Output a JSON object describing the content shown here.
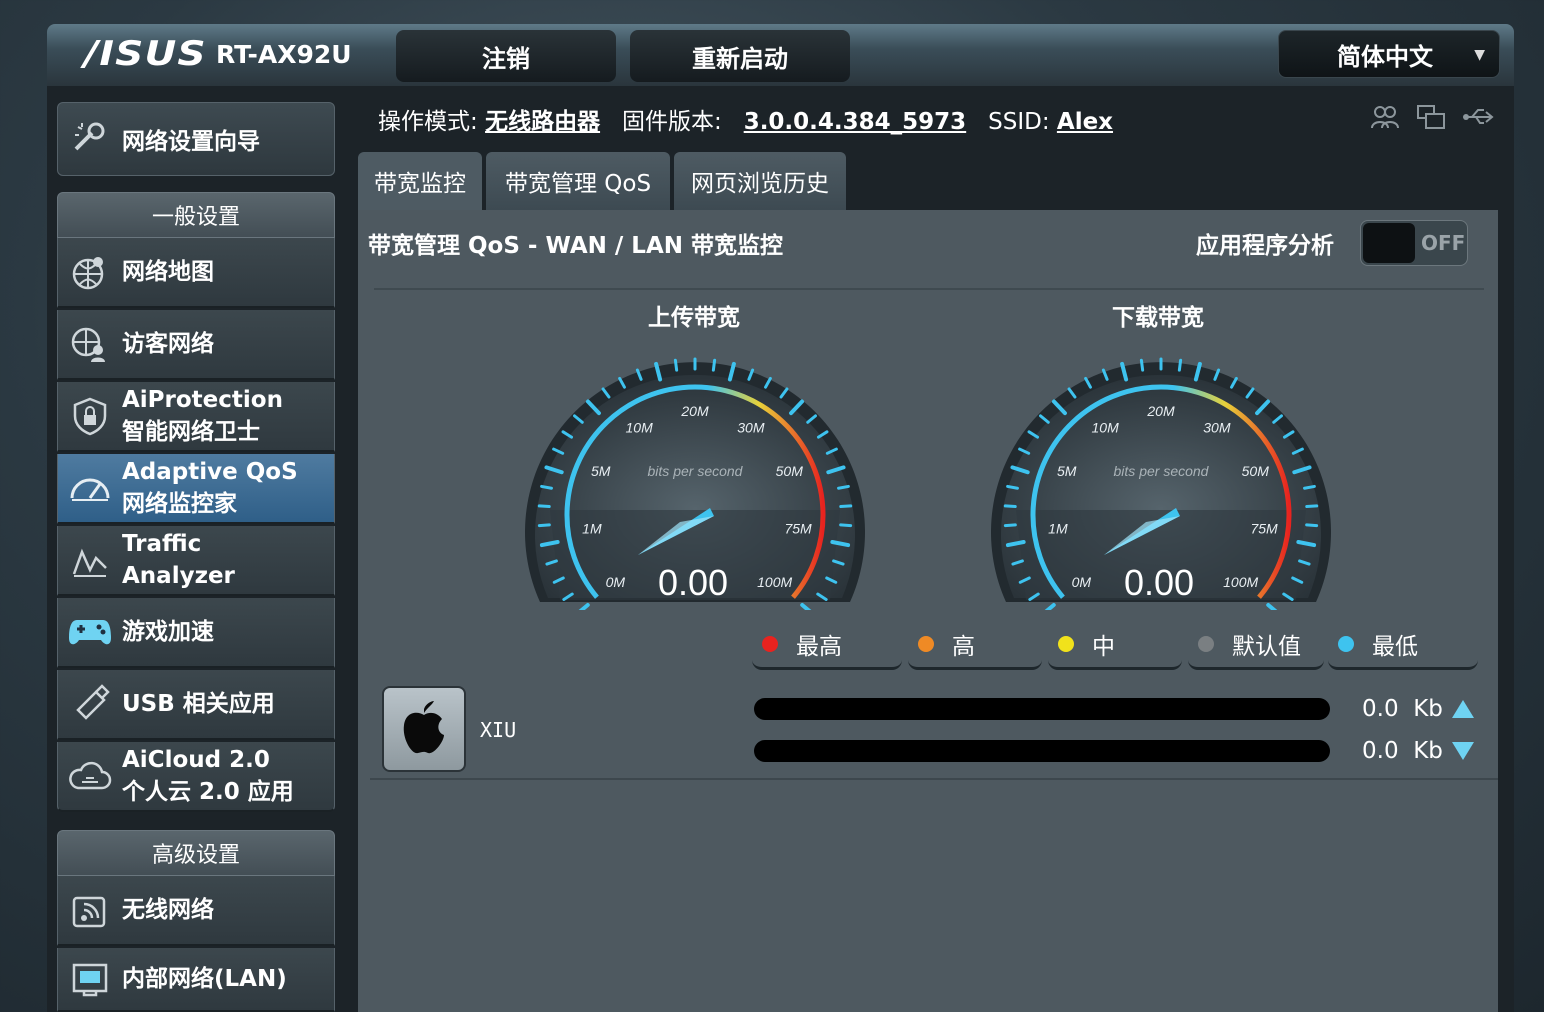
{
  "header": {
    "brand": "/ISUS",
    "model": "RT-AX92U",
    "logout_label": "注销",
    "reboot_label": "重新启动",
    "language": "简体中文"
  },
  "info": {
    "mode_label": "操作模式:",
    "mode_value": "无线路由器",
    "firmware_label": "固件版本:",
    "firmware_value": "3.0.0.4.384_5973",
    "ssid_label": "SSID:",
    "ssid_value": "Alex"
  },
  "sidebar": {
    "wizard": "网络设置向导",
    "general_header": "一般设置",
    "general_items": [
      {
        "label": "网络地图"
      },
      {
        "label": "访客网络"
      },
      {
        "label": "AiProtection",
        "label2": "智能网络卫士"
      },
      {
        "label": "Adaptive QoS",
        "label2": "网络监控家"
      },
      {
        "label": "Traffic",
        "label2": "Analyzer"
      },
      {
        "label": "游戏加速"
      },
      {
        "label": "USB 相关应用"
      },
      {
        "label": "AiCloud 2.0",
        "label2": "个人云 2.0 应用"
      }
    ],
    "advanced_header": "高级设置",
    "advanced_items": [
      {
        "label": "无线网络"
      },
      {
        "label": "内部网络(LAN)"
      }
    ]
  },
  "tabs": [
    "带宽监控",
    "带宽管理 QoS",
    "网页浏览历史"
  ],
  "panel": {
    "title": "带宽管理 QoS - WAN / LAN 带宽监控",
    "app_analysis_label": "应用程序分析",
    "app_analysis_state": "OFF"
  },
  "gauges": [
    {
      "title": "上传带宽",
      "value": "0.00",
      "unit_text": "bits per second",
      "ticks": [
        "0M",
        "1M",
        "5M",
        "10M",
        "20M",
        "30M",
        "50M",
        "75M",
        "100M"
      ]
    },
    {
      "title": "下载带宽",
      "value": "0.00",
      "unit_text": "bits per second",
      "ticks": [
        "0M",
        "1M",
        "5M",
        "10M",
        "20M",
        "30M",
        "50M",
        "75M",
        "100M"
      ]
    }
  ],
  "legend": [
    {
      "label": "最高",
      "color": "#e8231f"
    },
    {
      "label": "高",
      "color": "#ef8a25"
    },
    {
      "label": "中",
      "color": "#f1e21b"
    },
    {
      "label": "默认值",
      "color": "#7a7f82"
    },
    {
      "label": "最低",
      "color": "#3ec3ef"
    }
  ],
  "device": {
    "name": "XIU",
    "icon": "apple-icon",
    "upload_rate": "0.0",
    "upload_unit": "Kb",
    "download_rate": "0.0",
    "download_unit": "Kb"
  },
  "colors": {
    "accent_blue": "#4f7ba0",
    "gauge_cyan": "#3ec3ef"
  }
}
